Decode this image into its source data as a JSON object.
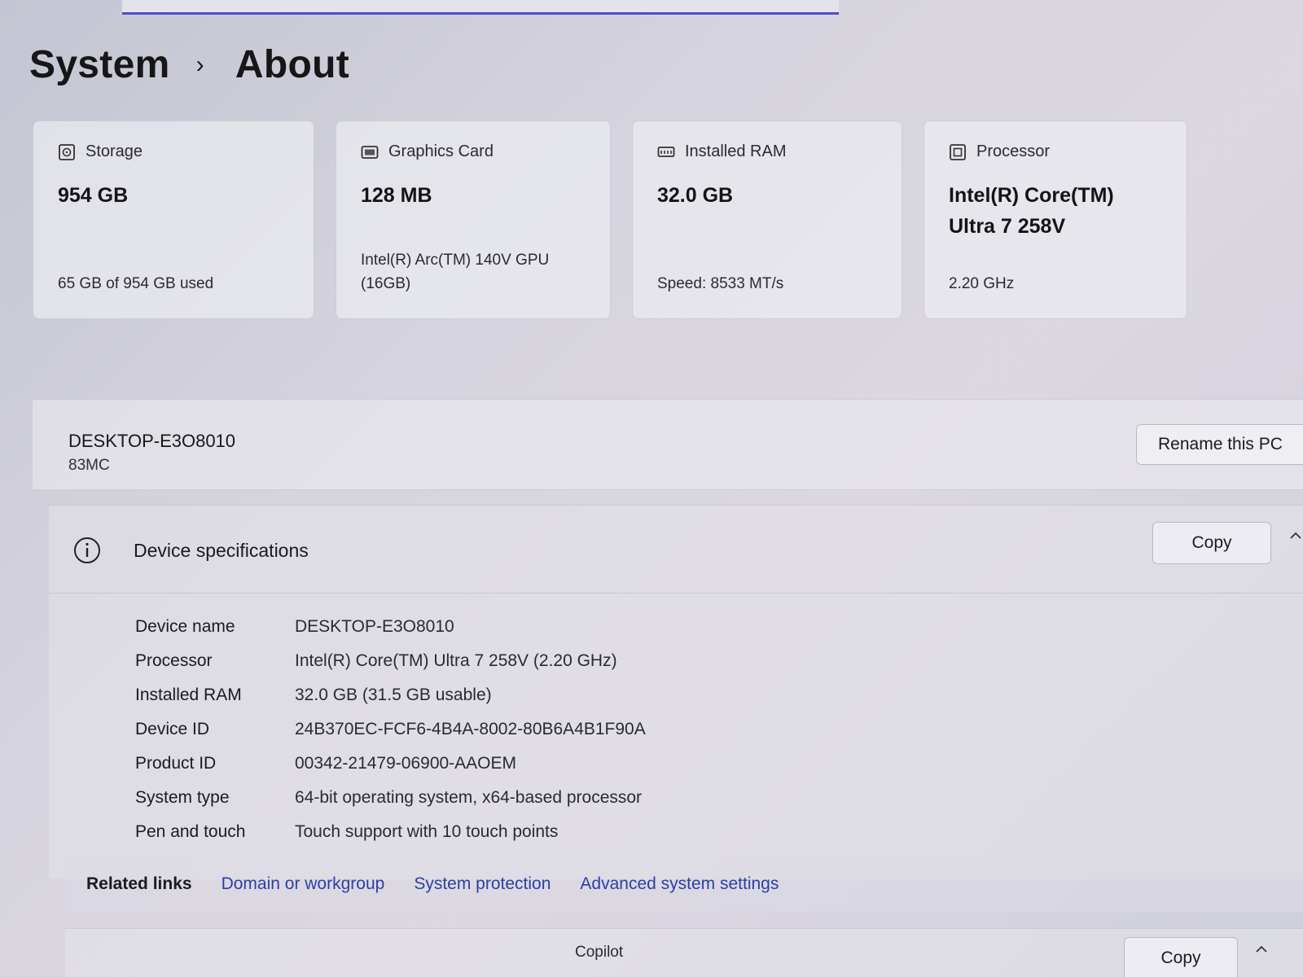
{
  "breadcrumb": {
    "parent": "System",
    "separator": "›",
    "current": "About"
  },
  "cards": [
    {
      "icon": "storage-icon",
      "label": "Storage",
      "value": "954 GB",
      "sub": "65 GB of 954 GB used"
    },
    {
      "icon": "graphics-card-icon",
      "label": "Graphics Card",
      "value": "128 MB",
      "sub": "Intel(R) Arc(TM) 140V GPU (16GB)"
    },
    {
      "icon": "ram-icon",
      "label": "Installed RAM",
      "value": "32.0 GB",
      "sub": "Speed: 8533 MT/s"
    },
    {
      "icon": "processor-icon",
      "label": "Processor",
      "value": "Intel(R) Core(TM) Ultra 7 258V",
      "sub": "2.20 GHz"
    }
  ],
  "pc": {
    "name": "DESKTOP-E3O8010",
    "model": "83MC",
    "rename_label": "Rename this PC"
  },
  "device_specs": {
    "title": "Device specifications",
    "copy_label": "Copy",
    "rows": [
      {
        "label": "Device name",
        "value": "DESKTOP-E3O8010"
      },
      {
        "label": "Processor",
        "value": "Intel(R) Core(TM) Ultra 7 258V (2.20 GHz)"
      },
      {
        "label": "Installed RAM",
        "value": "32.0 GB (31.5 GB usable)"
      },
      {
        "label": "Device ID",
        "value": "24B370EC-FCF6-4B4A-8002-80B6A4B1F90A"
      },
      {
        "label": "Product ID",
        "value": "00342-21479-06900-AAOEM"
      },
      {
        "label": "System type",
        "value": "64-bit operating system, x64-based processor"
      },
      {
        "label": "Pen and touch",
        "value": "Touch support with 10 touch points"
      }
    ]
  },
  "related": {
    "label": "Related links",
    "links": [
      "Domain or workgroup",
      "System protection",
      "Advanced system settings"
    ]
  },
  "next_section": {
    "copilot_label": "Copilot",
    "copy_label": "Copy"
  },
  "colors": {
    "link": "#2b3fa6",
    "accent": "#4b4fc7"
  }
}
